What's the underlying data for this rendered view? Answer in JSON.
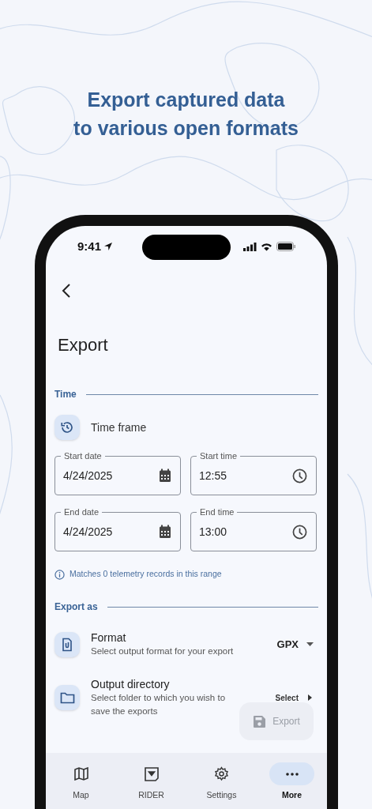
{
  "headline": [
    "Export captured data",
    "to various open formats"
  ],
  "status_bar": {
    "time": "9:41"
  },
  "page_title": "Export",
  "time_section": {
    "heading": "Time",
    "row_label": "Time frame",
    "fields": [
      {
        "label": "Start date",
        "value": "4/24/2025",
        "kind": "date"
      },
      {
        "label": "Start time",
        "value": "12:55",
        "kind": "time"
      },
      {
        "label": "End date",
        "value": "4/24/2025",
        "kind": "date"
      },
      {
        "label": "End time",
        "value": "13:00",
        "kind": "time"
      }
    ],
    "info": "Matches 0 telemetry records in this range"
  },
  "export_section": {
    "heading": "Export as",
    "rows": [
      {
        "kind": "dropdown",
        "title": "Format",
        "subtitle": "Select output format for your export",
        "value": "GPX"
      },
      {
        "kind": "picker",
        "title": "Output directory",
        "subtitle": "Select folder to which you wish to save the exports",
        "value": "Select"
      }
    ]
  },
  "export_button": {
    "label": "Export",
    "disabled": true
  },
  "nav": [
    {
      "label": "Map",
      "kind": "map",
      "selected": false
    },
    {
      "label": "RIDER",
      "kind": "rider",
      "selected": false
    },
    {
      "label": "Settings",
      "kind": "settings",
      "selected": false
    },
    {
      "label": "More",
      "kind": "more",
      "selected": true
    }
  ]
}
